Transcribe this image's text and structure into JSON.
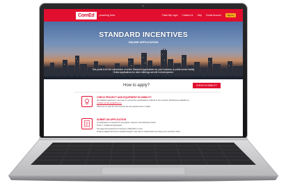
{
  "site": {
    "logo": "ComEd",
    "tagline": "powering lives",
    "nav": [
      "Trade Ally Login",
      "Contact Us",
      "Help",
      "Create Account"
    ],
    "sign_in": "Sign In",
    "accent_color": "#e10e2f"
  },
  "hero": {
    "title": "STANDARD INCENTIVES",
    "subtitle": "ONLINE APPLICATION",
    "text_line1": "This portal is for the submission of online Standard Applications for your business or public sector facility.",
    "text_line2": "Online applications for other offerings are still in development."
  },
  "how": {
    "title": "How to apply?",
    "button": "CHECK ELIGIBILITY"
  },
  "steps": [
    {
      "icon": "lightbulb-icon",
      "heading": "CHECK PROJECT AND EQUIPMENT ELIGIBILITY",
      "lines": [
        "All installed equipment must meet or exceed the specifications outlined in the Incentive Worksheets available on",
        "ComEd.com/EnergyEfficiency.",
        "Click here to view the full incentive list and requirements in detail."
      ]
    },
    {
      "icon": "application-icon",
      "heading": "SUBMIT AN APPLICATION",
      "lines": [
        "An application is required for all projects, based on the following Tracks:",
        "Track 1: Traditional Application",
        "Pre-approval required for incentives of $10,000 or more",
        "Projects eligible will not be verified through a site visit or review before we issue your incentive check."
      ]
    }
  ]
}
